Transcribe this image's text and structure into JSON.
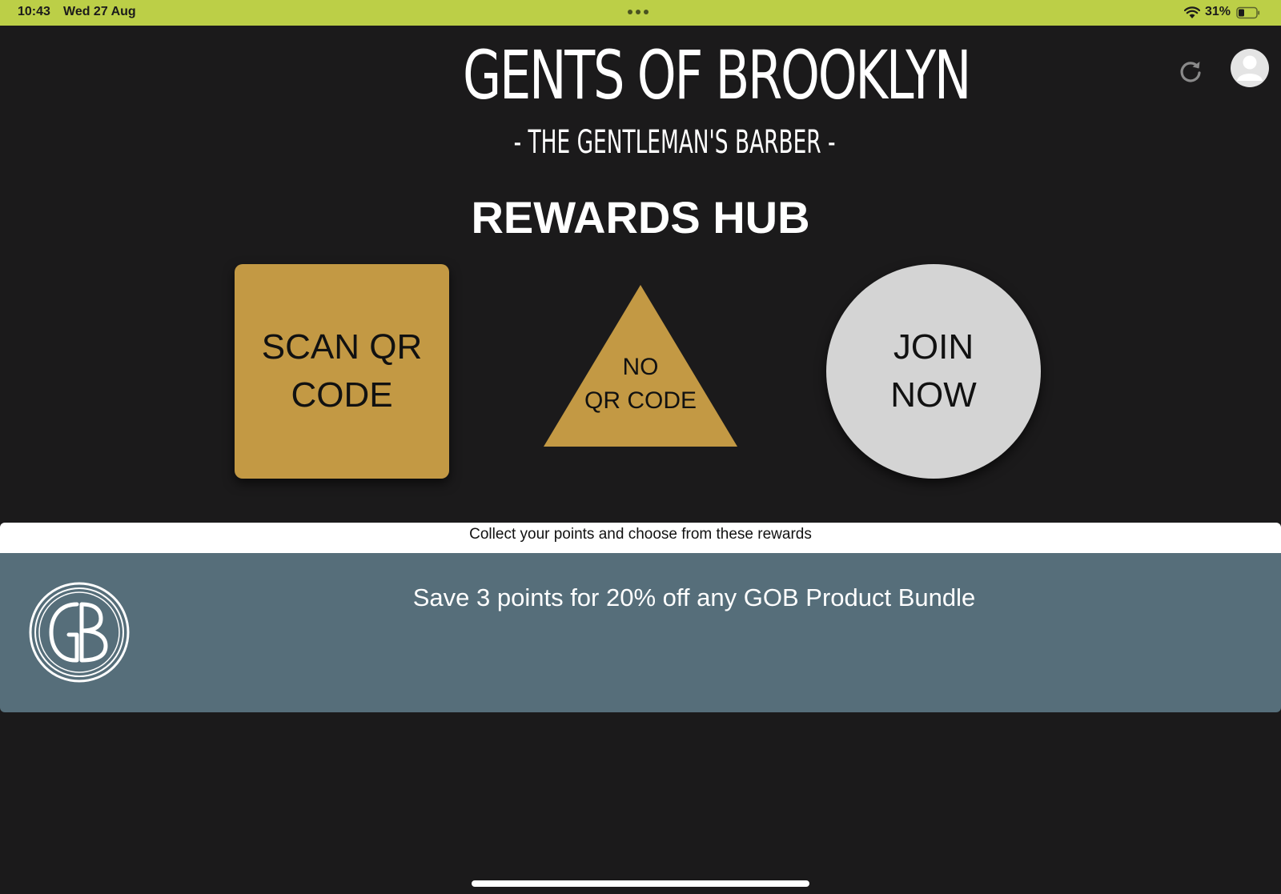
{
  "status_bar": {
    "time": "10:43",
    "date": "Wed 27 Aug",
    "battery_percent": "31%",
    "background_color": "#bccf47",
    "icons": [
      "multitasking-dots-icon",
      "wifi-icon",
      "battery-icon"
    ]
  },
  "header": {
    "brand_title": "GENTS OF BROOKLYN",
    "brand_subtitle": "- THE GENTLEMAN'S BARBER -",
    "icons": [
      "refresh-icon",
      "user-avatar-icon"
    ]
  },
  "main": {
    "heading": "REWARDS HUB",
    "actions": {
      "scan_label": "SCAN QR CODE",
      "no_qr_label_line1": "NO",
      "no_qr_label_line2": "QR CODE",
      "join_label": "JOIN NOW"
    },
    "action_colors": {
      "gold": "#c39944",
      "grey": "#d4d4d4"
    }
  },
  "rewards": {
    "caption": "Collect your points and choose from these rewards",
    "items": [
      {
        "logo_icon": "gb-monogram-logo",
        "text": "Save 3 points for 20% off any GOB Product Bundle",
        "card_color": "#566e7a"
      }
    ]
  },
  "colors": {
    "page_background": "#1b1a1b",
    "text_light": "#ffffff",
    "text_dark": "#111111"
  }
}
